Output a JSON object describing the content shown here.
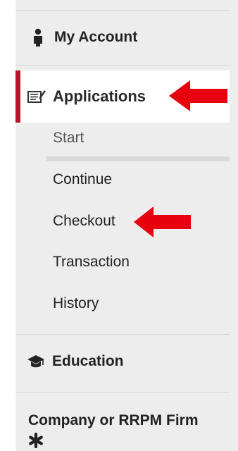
{
  "nav": {
    "my_account": "My Account",
    "applications": "Applications",
    "sub_items": [
      "Start",
      "Continue",
      "Checkout",
      "Transaction",
      "History"
    ],
    "education": "Education",
    "company": "Company or RRPM Firm"
  },
  "icons": {
    "my_account": "person-icon",
    "applications": "edit-document-icon",
    "education": "graduation-cap-icon",
    "company": "asterisk-icon"
  },
  "colors": {
    "active_border": "#b4162c",
    "arrow": "#e8000f",
    "panel_bg": "#ededed"
  }
}
